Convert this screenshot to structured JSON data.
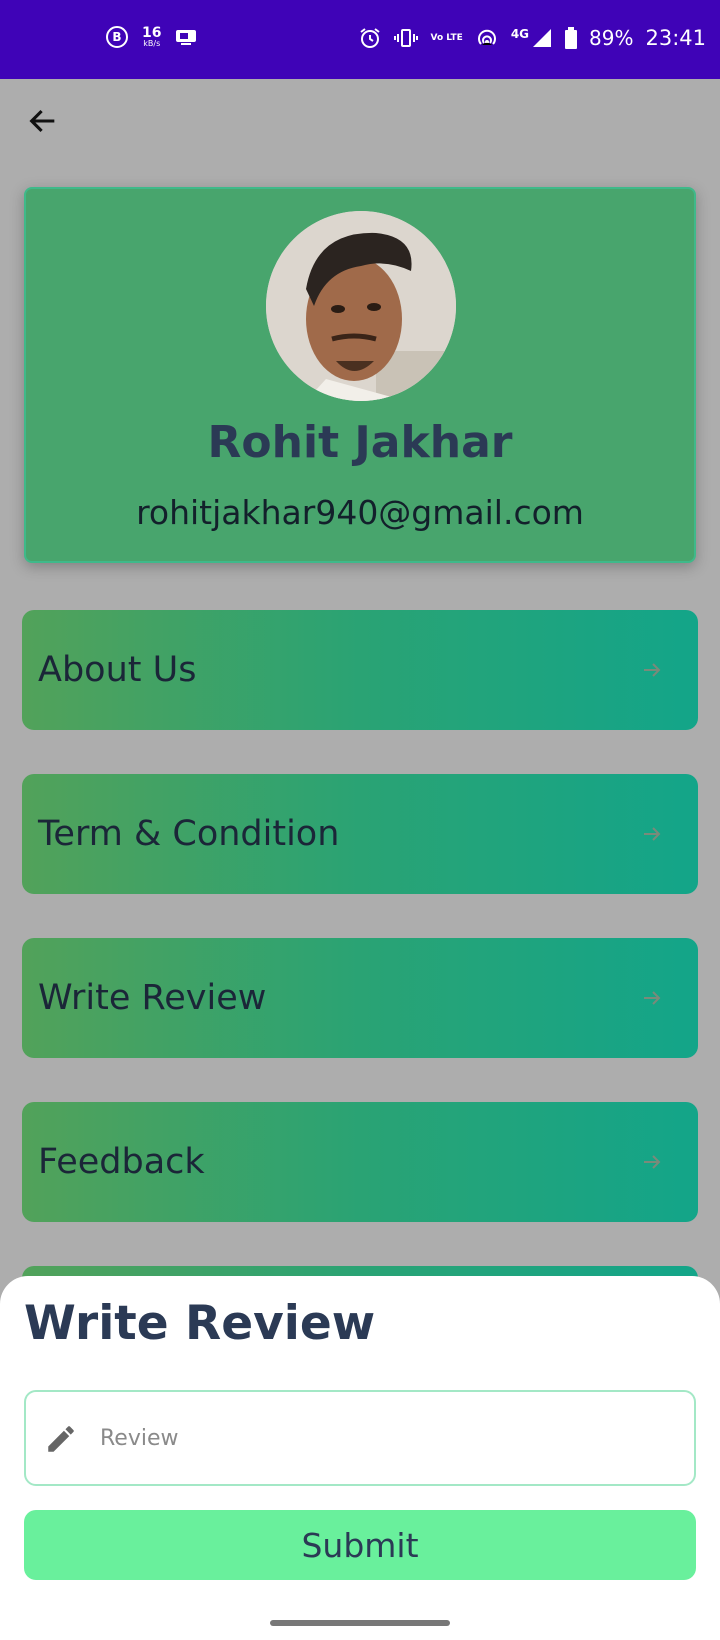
{
  "status_bar": {
    "speed_value": "16",
    "speed_unit": "kB/s",
    "volte_label": "Vo LTE",
    "network": "4G",
    "battery": "89%",
    "time": "23:41"
  },
  "profile": {
    "name": "Rohit Jakhar",
    "email": "rohitjakhar940@gmail.com"
  },
  "menu": {
    "items": [
      {
        "label": "About Us"
      },
      {
        "label": "Term & Condition"
      },
      {
        "label": "Write Review"
      },
      {
        "label": "Feedback"
      }
    ]
  },
  "sheet": {
    "title": "Write Review",
    "review_placeholder": "Review",
    "submit_label": "Submit"
  },
  "colors": {
    "status_bar": "#3f03b7",
    "card": "#48a56d",
    "submit": "#69f09c",
    "text_dark": "#2b3a55"
  }
}
